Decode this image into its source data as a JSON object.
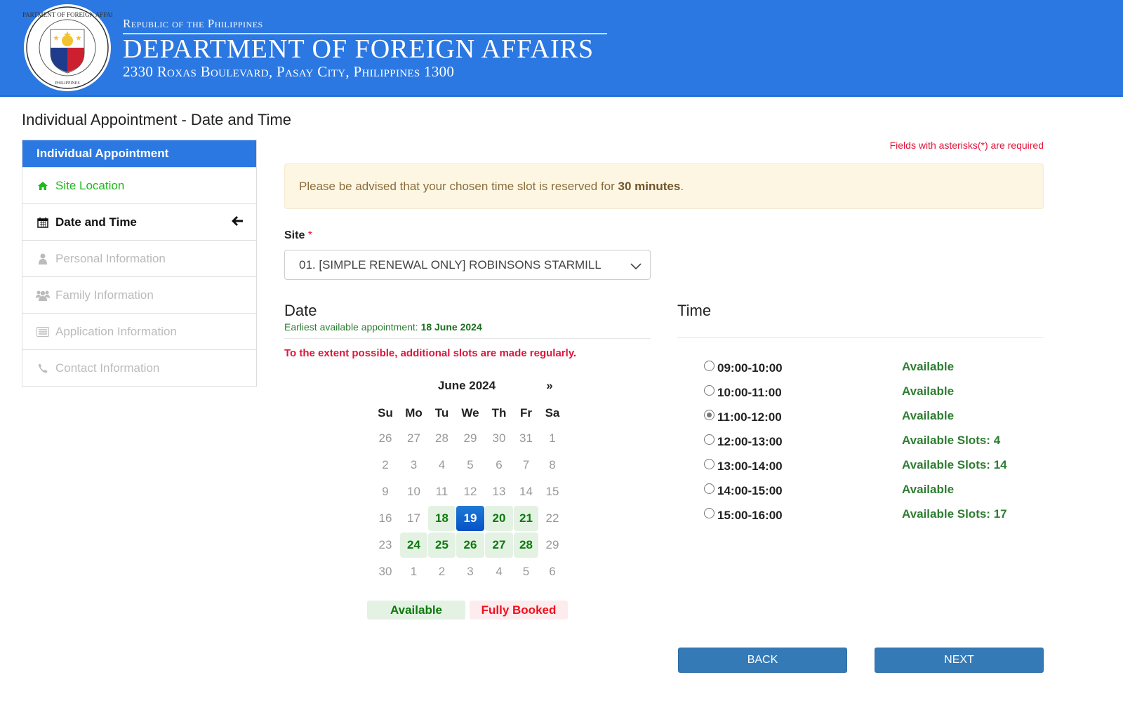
{
  "header": {
    "republic": "Republic of the Philippines",
    "department": "DEPARTMENT OF FOREIGN AFFAIRS",
    "address": "2330 Roxas Boulevard, Pasay City, Philippines 1300",
    "seal_icon": "dfa-seal-icon",
    "brand_color": "#2b78e2"
  },
  "page_title": "Individual Appointment - Date and Time",
  "sidebar": {
    "heading": "Individual Appointment",
    "items": [
      {
        "label": "Site Location",
        "icon": "home-icon",
        "state": "done"
      },
      {
        "label": "Date and Time",
        "icon": "calendar-icon",
        "state": "active"
      },
      {
        "label": "Personal Information",
        "icon": "user-icon",
        "state": "disabled"
      },
      {
        "label": "Family Information",
        "icon": "users-icon",
        "state": "disabled"
      },
      {
        "label": "Application Information",
        "icon": "list-icon",
        "state": "disabled"
      },
      {
        "label": "Contact Information",
        "icon": "phone-icon",
        "state": "disabled"
      }
    ],
    "active_indicator_icon": "arrow-left-icon"
  },
  "required_note": "Fields with asterisks(*) are required",
  "alert": {
    "text": "Please be advised that your chosen time slot is reserved for ",
    "bold": "30 minutes",
    "suffix": "."
  },
  "site": {
    "label": "Site",
    "required_mark": "*",
    "selected": "01. [SIMPLE RENEWAL ONLY] ROBINSONS STARMILLS"
  },
  "date": {
    "title": "Date",
    "earliest_label": "Earliest available appointment: ",
    "earliest_value": "18 June 2024",
    "note": "To the extent possible, additional slots are made regularly."
  },
  "calendar": {
    "month_label": "June 2024",
    "next_label": "»",
    "weekdays": [
      "Su",
      "Mo",
      "Tu",
      "We",
      "Th",
      "Fr",
      "Sa"
    ],
    "weeks": [
      [
        {
          "d": "26",
          "s": "other"
        },
        {
          "d": "27",
          "s": "other"
        },
        {
          "d": "28",
          "s": "other"
        },
        {
          "d": "29",
          "s": "other"
        },
        {
          "d": "30",
          "s": "other"
        },
        {
          "d": "31",
          "s": "other"
        },
        {
          "d": "1",
          "s": "none"
        }
      ],
      [
        {
          "d": "2",
          "s": "none"
        },
        {
          "d": "3",
          "s": "none"
        },
        {
          "d": "4",
          "s": "none"
        },
        {
          "d": "5",
          "s": "none"
        },
        {
          "d": "6",
          "s": "none"
        },
        {
          "d": "7",
          "s": "none"
        },
        {
          "d": "8",
          "s": "none"
        }
      ],
      [
        {
          "d": "9",
          "s": "none"
        },
        {
          "d": "10",
          "s": "none"
        },
        {
          "d": "11",
          "s": "none"
        },
        {
          "d": "12",
          "s": "none"
        },
        {
          "d": "13",
          "s": "none"
        },
        {
          "d": "14",
          "s": "none"
        },
        {
          "d": "15",
          "s": "none"
        }
      ],
      [
        {
          "d": "16",
          "s": "none"
        },
        {
          "d": "17",
          "s": "none"
        },
        {
          "d": "18",
          "s": "available"
        },
        {
          "d": "19",
          "s": "selected"
        },
        {
          "d": "20",
          "s": "available"
        },
        {
          "d": "21",
          "s": "available"
        },
        {
          "d": "22",
          "s": "none"
        }
      ],
      [
        {
          "d": "23",
          "s": "none"
        },
        {
          "d": "24",
          "s": "available"
        },
        {
          "d": "25",
          "s": "available"
        },
        {
          "d": "26",
          "s": "available"
        },
        {
          "d": "27",
          "s": "available"
        },
        {
          "d": "28",
          "s": "available"
        },
        {
          "d": "29",
          "s": "none"
        }
      ],
      [
        {
          "d": "30",
          "s": "none"
        },
        {
          "d": "1",
          "s": "other"
        },
        {
          "d": "2",
          "s": "other"
        },
        {
          "d": "3",
          "s": "other"
        },
        {
          "d": "4",
          "s": "other"
        },
        {
          "d": "5",
          "s": "other"
        },
        {
          "d": "6",
          "s": "other"
        }
      ]
    ],
    "legend": {
      "available": "Available",
      "fully_booked": "Fully Booked"
    },
    "colors": {
      "available_bg": "#e4f2e4",
      "available_text": "#0d7a0d",
      "selected_bg": "#0552c6",
      "booked_text": "#f0101c"
    }
  },
  "time": {
    "title": "Time",
    "slots": [
      {
        "label": "09:00-10:00",
        "status": "Available",
        "checked": false
      },
      {
        "label": "10:00-11:00",
        "status": "Available",
        "checked": false
      },
      {
        "label": "11:00-12:00",
        "status": "Available",
        "checked": true
      },
      {
        "label": "12:00-13:00",
        "status": "Available Slots: 4",
        "checked": false
      },
      {
        "label": "13:00-14:00",
        "status": "Available Slots: 14",
        "checked": false
      },
      {
        "label": "14:00-15:00",
        "status": "Available",
        "checked": false
      },
      {
        "label": "15:00-16:00",
        "status": "Available Slots: 17",
        "checked": false
      }
    ]
  },
  "buttons": {
    "back": "BACK",
    "next": "NEXT"
  }
}
